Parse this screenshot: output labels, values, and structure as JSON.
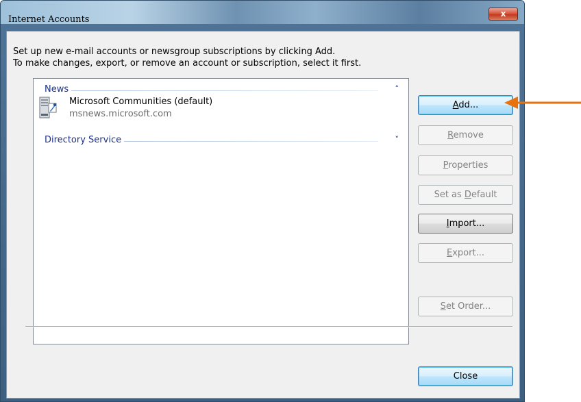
{
  "window": {
    "title": "Internet Accounts",
    "close_glyph": "x"
  },
  "instructions": {
    "line1": "Set up new e-mail accounts or newsgroup subscriptions by clicking Add.",
    "line2": "To make changes, export, or remove an account or subscription, select it first."
  },
  "list": {
    "groups": [
      {
        "label": "News",
        "chevron": "˄",
        "items": [
          {
            "name": "Microsoft Communities (default)",
            "server": "msnews.microsoft.com",
            "icon": "news-server-icon"
          }
        ]
      },
      {
        "label": "Directory Service",
        "chevron": "˅",
        "items": []
      }
    ]
  },
  "buttons": {
    "add": {
      "access_key": "A",
      "rest": "dd...",
      "enabled": true
    },
    "remove": {
      "access_key": "R",
      "rest": "emove",
      "enabled": false
    },
    "properties": {
      "access_key": "P",
      "rest": "roperties",
      "enabled": false
    },
    "set_default": {
      "prefix": "Set as ",
      "access_key": "D",
      "rest": "efault",
      "enabled": false
    },
    "import": {
      "access_key": "I",
      "rest": "mport...",
      "enabled": true
    },
    "export": {
      "access_key": "E",
      "rest": "xport...",
      "enabled": false
    },
    "set_order": {
      "access_key": "S",
      "rest": "et Order...",
      "enabled": false
    },
    "close": {
      "label": "Close",
      "enabled": true
    }
  },
  "colors": {
    "accent_arrow": "#e8730c",
    "group_header": "#1e3287"
  }
}
